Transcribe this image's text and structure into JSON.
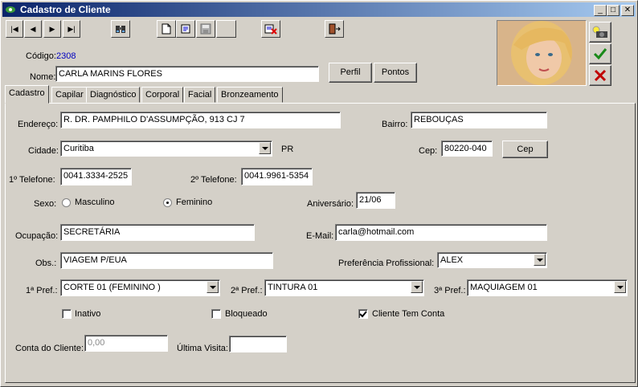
{
  "window": {
    "title": "Cadastro de Cliente",
    "minimize": "_",
    "maximize": "□",
    "close": "✕"
  },
  "toolbar": {
    "first": "|◀",
    "prev": "◀",
    "next": "▶",
    "last": "▶|"
  },
  "header": {
    "codigo_label": "Código:",
    "codigo_value": "2308",
    "nome_label": "Nome:",
    "nome_value": "CARLA MARINS FLORES",
    "perfil_button": "Perfil",
    "pontos_button": "Pontos"
  },
  "tabs": [
    "Cadastro",
    "Capilar",
    "Diagnóstico",
    "Corporal",
    "Facial",
    "Bronzeamento"
  ],
  "form": {
    "endereco_label": "Endereço:",
    "endereco_value": "R. DR. PAMPHILO D'ASSUMPÇÃO, 913 CJ 7",
    "bairro_label": "Bairro:",
    "bairro_value": "REBOUÇAS",
    "cidade_label": "Cidade:",
    "cidade_value": "Curitiba",
    "uf_value": "PR",
    "cep_label": "Cep:",
    "cep_value": "80220-040",
    "cep_button": "Cep",
    "tel1_label": "1º Telefone:",
    "tel1_value": "0041.3334-2525",
    "tel2_label": "2º Telefone:",
    "tel2_value": "0041.9961-5354",
    "sexo_label": "Sexo:",
    "sexo_masc": "Masculino",
    "sexo_fem": "Feminino",
    "aniversario_label": "Aniversário:",
    "aniversario_value": "21/06",
    "ocupacao_label": "Ocupação:",
    "ocupacao_value": "SECRETÁRIA",
    "email_label": "E-Mail:",
    "email_value": "carla@hotmail.com",
    "obs_label": "Obs.:",
    "obs_value": "VIAGEM P/EUA",
    "preferencia_label": "Preferência Profissional:",
    "preferencia_value": "ALEX",
    "pref1_label": "1ª Pref.:",
    "pref1_value": "CORTE  01  (FEMININO )",
    "pref2_label": "2ª Pref.:",
    "pref2_value": "TINTURA   01",
    "pref3_label": "3ª Pref.:",
    "pref3_value": "MAQUIAGEM  01",
    "inativo_label": "Inativo",
    "bloqueado_label": "Bloqueado",
    "cliente_conta_label": "Cliente Tem Conta",
    "conta_label": "Conta do Cliente:",
    "conta_value": "0,00",
    "ultima_visita_label": "Última Visita:",
    "ultima_visita_value": ""
  },
  "colors": {
    "codigo_value": "#0000c0",
    "titlebar_start": "#0a246a",
    "titlebar_end": "#a6caf0",
    "confirm": "#1a8a1a",
    "cancel": "#c00000"
  }
}
